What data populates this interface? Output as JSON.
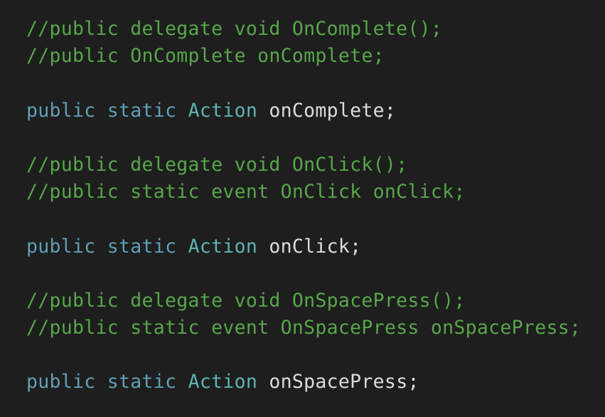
{
  "colors": {
    "background": "#1e1e1e",
    "comment": "#57a64a",
    "keyword": "#5f9fb5",
    "type": "#5fb3b3",
    "identifier": "#dcdcdc"
  },
  "code": {
    "block1": {
      "comment1": "//public delegate void OnComplete();",
      "comment2": "//public OnComplete onComplete;",
      "kw_public": "public",
      "kw_static": "static",
      "type": "Action",
      "identifier": "onComplete;"
    },
    "block2": {
      "comment1": "//public delegate void OnClick();",
      "comment2": "//public static event OnClick onClick;",
      "kw_public": "public",
      "kw_static": "static",
      "type": "Action",
      "identifier": "onClick;"
    },
    "block3": {
      "comment1": "//public delegate void OnSpacePress();",
      "comment2": "//public static event OnSpacePress onSpacePress;",
      "kw_public": "public",
      "kw_static": "static",
      "type": "Action",
      "identifier": "onSpacePress;"
    }
  }
}
